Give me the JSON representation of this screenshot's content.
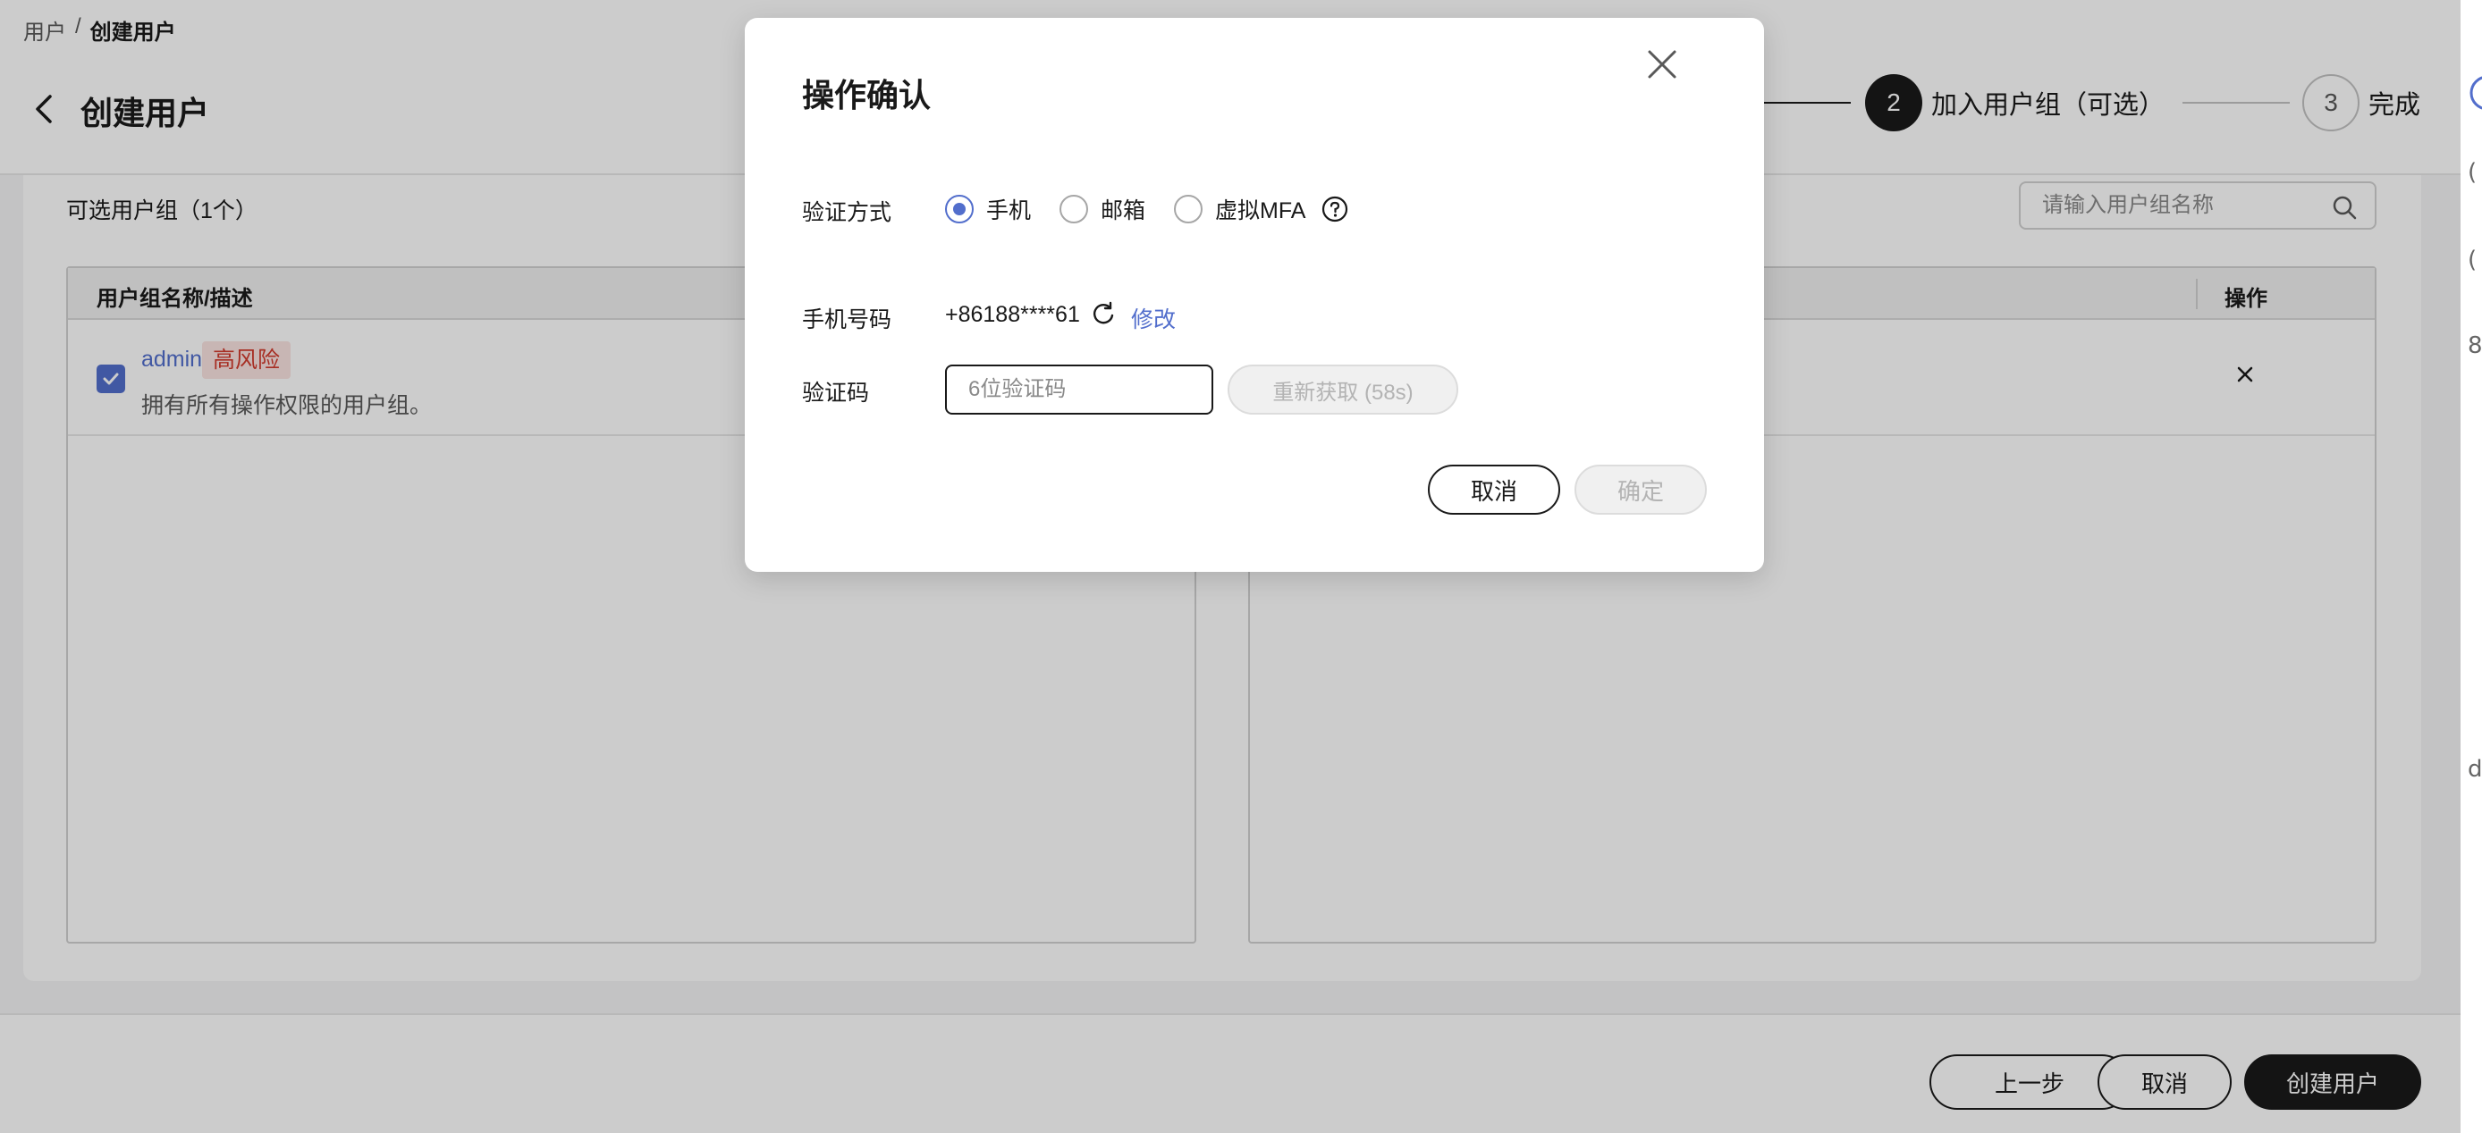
{
  "breadcrumb": {
    "parent": "用户",
    "separator": "/",
    "current": "创建用户"
  },
  "page": {
    "title": "创建用户"
  },
  "steps": [
    {
      "number": "2",
      "label": "加入用户组（可选）",
      "state": "active"
    },
    {
      "number": "3",
      "label": "完成",
      "state": "pending"
    }
  ],
  "available_groups": {
    "title": "可选用户组（1个）",
    "search_placeholder": "请输入用户组名称",
    "columns": {
      "name_desc": "用户组名称/描述"
    },
    "rows": [
      {
        "name": "admin",
        "risk_tag": "高风险",
        "description": "拥有所有操作权限的用户组。",
        "checked": true
      }
    ]
  },
  "selected_groups": {
    "columns": {
      "action": "操作"
    }
  },
  "footer": {
    "prev_label": "上一步",
    "cancel_label": "取消",
    "create_label": "创建用户"
  },
  "modal": {
    "title": "操作确认",
    "verify_method_label": "验证方式",
    "methods": [
      {
        "label": "手机",
        "checked": true
      },
      {
        "label": "邮箱",
        "checked": false
      },
      {
        "label": "虚拟MFA",
        "checked": false
      }
    ],
    "phone_label": "手机号码",
    "phone_value": "+86188****61",
    "modify_label": "修改",
    "code_label": "验证码",
    "code_placeholder": "6位验证码",
    "resend_label": "重新获取 (58s)",
    "cancel_label": "取消",
    "confirm_label": "确定"
  },
  "colors": {
    "accent": "#526ecc",
    "primary": "#191919",
    "danger": "#d13b2e",
    "danger_bg": "#fbe4e2"
  }
}
